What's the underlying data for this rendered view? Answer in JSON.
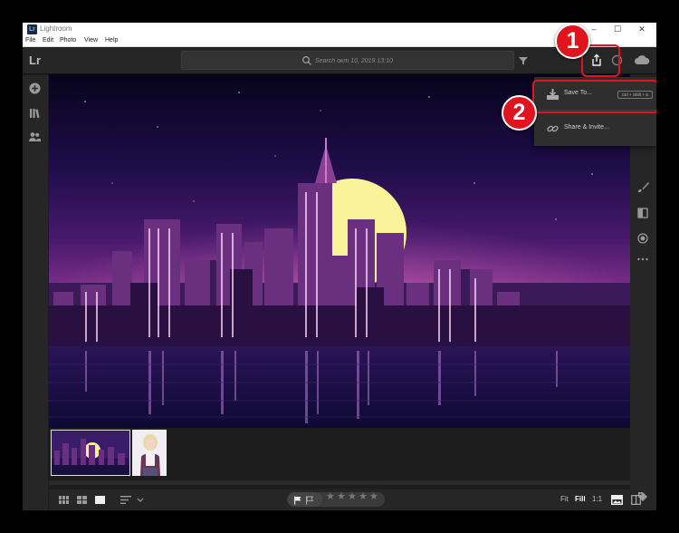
{
  "window": {
    "title": "Lightroom",
    "app_icon_label": "Lr",
    "controls": [
      "–",
      "☐",
      "✕"
    ]
  },
  "menubar": {
    "items": [
      "File",
      "Edit",
      "Photo",
      "View",
      "Help"
    ]
  },
  "toolbar": {
    "logo": "Lr",
    "search_placeholder": "Search окт 10, 2019 13:10"
  },
  "share_menu": {
    "items": [
      {
        "label": "Save To...",
        "shortcut": "Ctrl + Shift + S",
        "icon": "save-to-icon"
      },
      {
        "label": "Share & Invite...",
        "icon": "link-icon"
      }
    ]
  },
  "bottombar": {
    "zoom_options": [
      "Fit",
      "Fill",
      "1:1"
    ],
    "selected_zoom": "Fill",
    "stars_total": 5,
    "stars_rating": 0
  },
  "annotations": {
    "badge1": "1",
    "badge2": "2"
  },
  "colors": {
    "highlight": "#e0141e",
    "panel": "#262626",
    "background": "#1d1d1d"
  }
}
